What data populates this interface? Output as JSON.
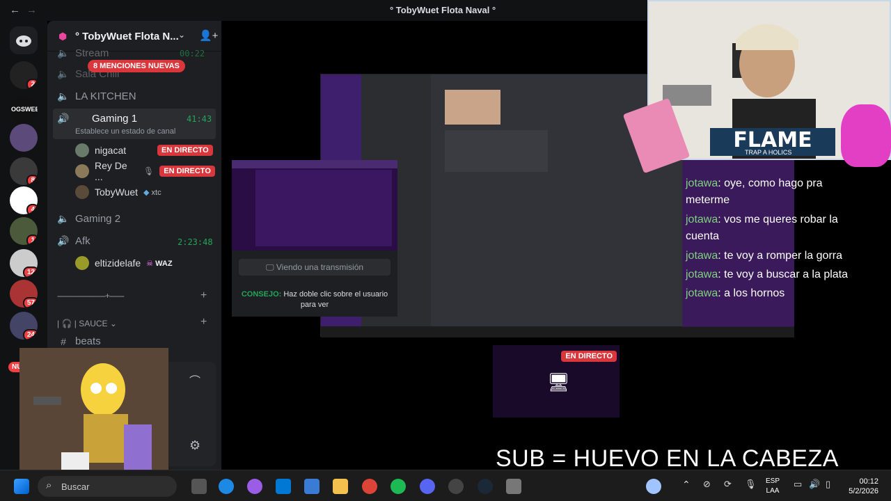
{
  "window": {
    "title": "° TobyWuet Flota Naval °",
    "back_icon": "arrow-left-icon",
    "forward_icon": "arrow-right-icon"
  },
  "server": {
    "name": "° TobyWuet Flota N...",
    "mentions": "8 MENCIONES NUEVAS"
  },
  "rail": {
    "badges": [
      "2",
      "8",
      "4",
      "1",
      "12",
      "57",
      "24"
    ],
    "nuevo": "NUEVO"
  },
  "channels": [
    {
      "name": "Stream",
      "timer": "00:22"
    },
    {
      "name": "Sala Chill"
    },
    {
      "name": "LA KITCHEN"
    },
    {
      "name": "Gaming 1",
      "timer": "41:43",
      "status": "Establece un estado de canal"
    },
    {
      "name": "Gaming 2"
    },
    {
      "name": "Afk",
      "timer": "2:23:48"
    }
  ],
  "users": [
    {
      "name": "nigacat",
      "live": "EN DIRECTO"
    },
    {
      "name": "Rey De ...",
      "live": "EN DIRECTO"
    },
    {
      "name": "TobyWuet",
      "tag": "xtc"
    },
    {
      "name": "eltizidelafe",
      "tag": "WAZ"
    }
  ],
  "category": {
    "name": "SAUCE",
    "divider": "-----------------------+-------"
  },
  "beats": "beats",
  "stream": {
    "viewing": "Viendo una transmisión",
    "tip_label": "CONSEJO:",
    "tip_text": "Haz doble clic sobre el usuario para ver",
    "live": "EN DIRECTO"
  },
  "chat": [
    {
      "user": "jotawa",
      "msg": "oye, como hago pra meterme"
    },
    {
      "user": "jotawa",
      "msg": "vos me queres robar la cuenta"
    },
    {
      "user": "jotawa",
      "msg": "te voy a romper la gorra"
    },
    {
      "user": "jotawa",
      "msg": "te voy a buscar a la plata"
    },
    {
      "user": "jotawa",
      "msg": "a los hornos"
    }
  ],
  "overlay_logo": "FLAME",
  "overlay_sub": "TRAP A HOLICS",
  "caption": "SUB = HUEVO EN LA CABEZA",
  "taskbar": {
    "search": "Buscar",
    "lang1": "ESP",
    "lang2": "LAA",
    "time": "00:12",
    "date": "5/2/2026"
  },
  "colors": {
    "accent": "#5865f2",
    "live": "#da373c",
    "online": "#23a55a"
  }
}
